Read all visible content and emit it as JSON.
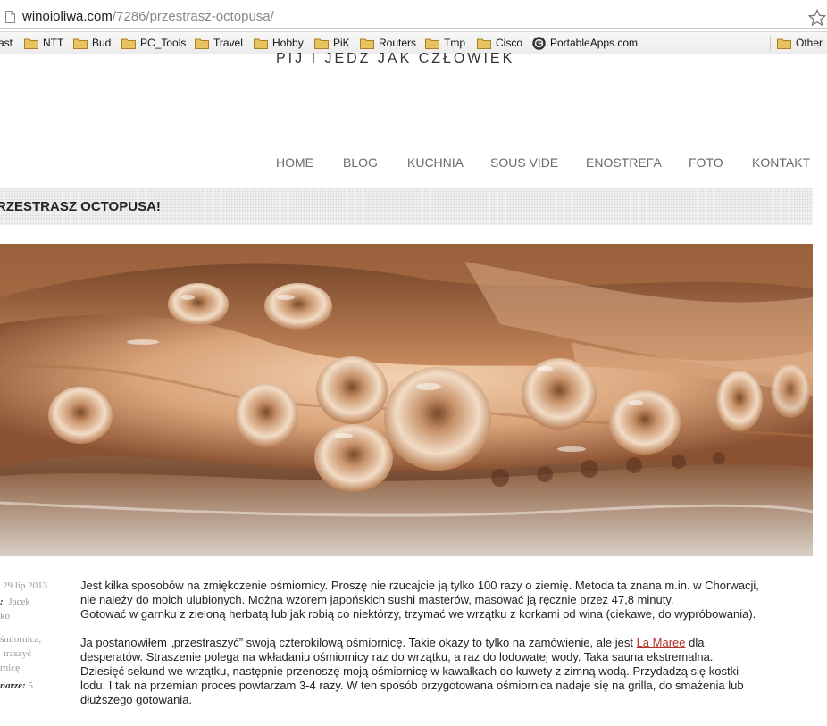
{
  "browser": {
    "url_host": "winoioliwa.com",
    "url_path": "/7286/przestrasz-octopusa/",
    "bookmarks": [
      "ast",
      "NTT",
      "Bud",
      "PC_Tools",
      "Travel",
      "Hobby",
      "PiK",
      "Routers",
      "Tmp",
      "Cisco",
      "PortableApps.com",
      "Other"
    ]
  },
  "site": {
    "tagline": "PIJ I JEDZ JAK CZŁOWIEK"
  },
  "nav": {
    "items": [
      "HOME",
      "BLOG",
      "KUCHNIA",
      "SOUS VIDE",
      "ENOSTREFA",
      "FOTO",
      "KONTAKT"
    ]
  },
  "post": {
    "title": "RZESTRASZ OCTOPUSA!",
    "meta": {
      "date": "29 lip 2013",
      "author_label": ":",
      "author_1": "Jacek",
      "author_2": "ko",
      "tags_1": "śmiornica,",
      "tags_2": "traszyć",
      "tags_3": "rnicę",
      "comments_label": "narze:",
      "comments_count": "5"
    },
    "p1": [
      "Jest kilka sposobów na zmiękczenie ośmiornicy. Proszę nie rzucajcie ją tylko 100 razy o ziemię. Metoda ta znana m.in. w Chorwacji,",
      "nie należy do moich ulubionych. Można wzorem japońskich sushi masterów, masować ją ręcznie przez 47,8 minuty.",
      "Gotować w garnku z zieloną herbatą lub jak robią co niektórzy, trzymać we wrzątku z korkami od wina (ciekawe, do wypróbowania)."
    ],
    "p2_line1_pre": "Ja postanowiłem „przestraszyć” swoją czterokilową ośmiornicę. Takie okazy to tylko na zamówienie, ale jest ",
    "p2_link": "La Maree",
    "p2_line1_post": " dla",
    "p2_rest": [
      "desperatów. Straszenie polega na wkładaniu ośmiornicy raz do wrzątku, a raz do lodowatej wody. Taka sauna ekstremalna.",
      "Dziesięć sekund we wrzątku, następnie przenoszę moją ośmiornicę w kawałkach do kuwety z zimną wodą. Przydadzą się kostki",
      "lodu. I tak na przemian proces powtarzam 3-4 razy. W ten sposób przygotowana ośmiornica nadaje się na grilla, do smażenia lub",
      "dłuższego gotowania."
    ]
  },
  "colors": {
    "link": "#b0332c",
    "nav_text": "#6a6a6a",
    "folder": "#e8c25c"
  }
}
